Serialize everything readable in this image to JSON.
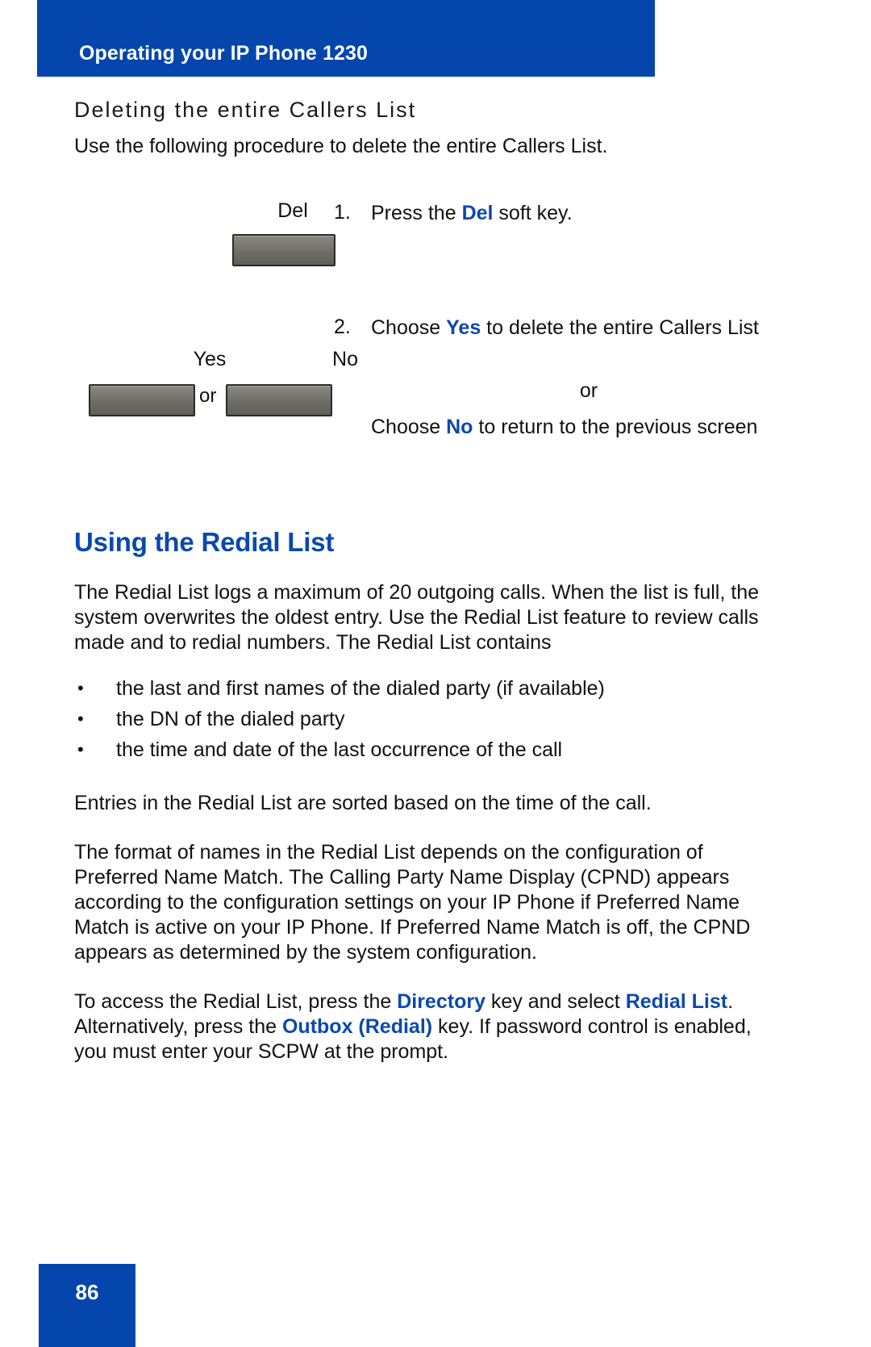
{
  "page": {
    "number": "86",
    "accent_blue": "#0546ad",
    "text_blue": "#0a49ad"
  },
  "header": {
    "title": "Operating your IP Phone 1230"
  },
  "section_callers": {
    "heading": "Deleting the entire Callers List",
    "intro": "Use the following procedure to delete the entire Callers List.",
    "steps": [
      {
        "number": "1.",
        "text_before": "Press the ",
        "key": "Del",
        "text_after": " soft key.",
        "softkeys": [
          {
            "label": "Del"
          }
        ]
      },
      {
        "number": "2.",
        "line1_before": "Choose ",
        "line1_key": "Yes",
        "line1_after": " to delete the entire Callers List",
        "or": "or",
        "line2_before": "Choose ",
        "line2_key": "No",
        "line2_after": " to return to the previous screen",
        "softkeys": [
          {
            "label": "Yes"
          },
          {
            "label": "No"
          }
        ],
        "softkey_separator": "or"
      }
    ]
  },
  "section_redial": {
    "heading": "Using the Redial List",
    "paragraph_1": "The Redial List logs a maximum of 20 outgoing calls. When the list is full, the system overwrites the oldest entry. Use the Redial List feature to review calls made and to redial numbers. The Redial List contains",
    "bullets": [
      "the last and first names of the dialed party (if available)",
      "the DN of the dialed party",
      "the time and date of the last occurrence of the call"
    ],
    "bullet_glyph": "•",
    "paragraph_2": "Entries in the Redial List are sorted based on the time of the call.",
    "paragraph_3": "The format of names in the Redial List depends on the configuration of Preferred Name Match. The Calling Party Name Display (CPND) appears according to the configuration settings on your IP Phone if Preferred Name Match is active on your IP Phone. If Preferred Name Match is off, the CPND appears as determined by the system configuration.",
    "paragraph_4": {
      "part_1": "To access the Redial List, press the ",
      "key_1": "Directory",
      "part_2": " key and select ",
      "key_2": "Redial List",
      "part_3": ". Alternatively, press the ",
      "key_3": "Outbox (Redial)",
      "part_4": " key. If password control is enabled, you must enter your SCPW at the prompt."
    }
  }
}
